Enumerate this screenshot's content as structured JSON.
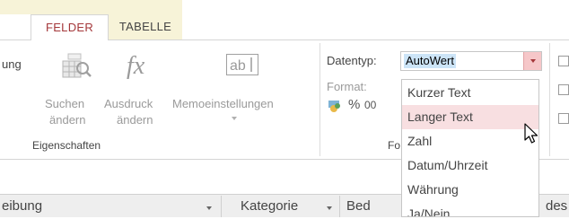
{
  "tabs": [
    {
      "label": "FELDER",
      "active": true
    },
    {
      "label": "TABELLE",
      "active": false
    }
  ],
  "ribbon": {
    "partial_label": "ung",
    "buttons": [
      {
        "line1": "Suchen",
        "line2": "ändern",
        "icon": "lookup-table-icon"
      },
      {
        "line1": "Ausdruck",
        "line2": "ändern",
        "icon": "fx-icon"
      },
      {
        "line1": "Memoeinstellungen",
        "line2": "",
        "icon": "memo-ab-icon"
      }
    ],
    "group_label": "Eigenschaften",
    "datentyp_label": "Datentyp:",
    "format_label": "Format:",
    "format_group_partial": "Fo",
    "percent_symbol": "%",
    "partial_00": "00"
  },
  "datatype": {
    "selected": "AutoWert",
    "options": [
      "Kurzer Text",
      "Langer Text",
      "Zahl",
      "Datum/Uhrzeit",
      "Währung",
      "Ja/Nein"
    ],
    "hovered_index": 1
  },
  "grid": {
    "columns": [
      "eibung",
      "Kategorie",
      "Bed",
      "des"
    ]
  },
  "colors": {
    "accent": "#a4373a",
    "contextual_tab": "#f7f3d8",
    "hover": "#f8dfe1",
    "selection": "#cce4f7"
  }
}
